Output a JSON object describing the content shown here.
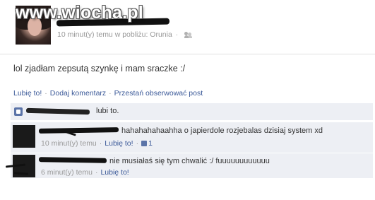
{
  "watermark": {
    "text": "www.wiocha.pl"
  },
  "post": {
    "meta_time": "10 minut(y) temu w pobliżu: Orunia",
    "meta_sep": "·",
    "status_text": "lol zjadłam zepsutą szynkę i mam sraczke :/"
  },
  "actions": {
    "like": "Lubię to!",
    "dot": "·",
    "comment": "Dodaj komentarz",
    "unfollow": "Przestań obserwować post"
  },
  "likes": {
    "text": "lubi to."
  },
  "comments": [
    {
      "text": "hahahahahaahha o japierdole rozjebalas dzisiaj system xd",
      "time": "10 minut(y) temu",
      "like": "Lubię to!",
      "dot": "·",
      "like_count": "1"
    },
    {
      "text": "nie musiałaś się tym chwalić :/ fuuuuuuuuuuuu",
      "time": "6 minut(y) temu",
      "like": "Lubię to!",
      "dot": "·"
    }
  ],
  "colors": {
    "link": "#3b5998",
    "panel": "#edeff4",
    "meta": "#999999",
    "text": "#333333"
  }
}
